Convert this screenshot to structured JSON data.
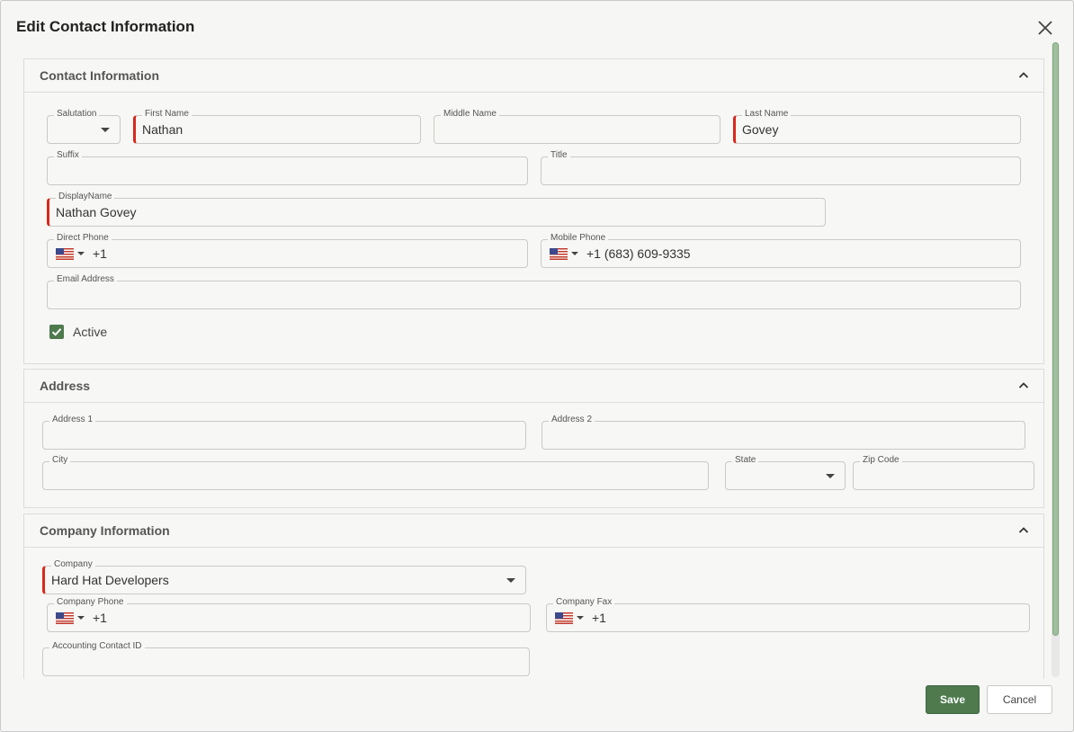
{
  "dialog": {
    "title": "Edit Contact Information"
  },
  "contact_section": {
    "title": "Contact Information",
    "salutation": {
      "label": "Salutation",
      "value": ""
    },
    "first_name": {
      "label": "First Name",
      "value": "Nathan"
    },
    "middle_name": {
      "label": "Middle Name",
      "value": ""
    },
    "last_name": {
      "label": "Last Name",
      "value": "Govey"
    },
    "suffix": {
      "label": "Suffix",
      "value": ""
    },
    "title_field": {
      "label": "Title",
      "value": ""
    },
    "display_name": {
      "label": "DisplayName",
      "value": "Nathan Govey"
    },
    "direct_phone": {
      "label": "Direct Phone",
      "value": "+1"
    },
    "mobile_phone": {
      "label": "Mobile Phone",
      "value": "+1 (683) 609-9335"
    },
    "email": {
      "label": "Email Address",
      "value": ""
    },
    "active": {
      "label": "Active",
      "checked": true
    }
  },
  "address_section": {
    "title": "Address",
    "address1": {
      "label": "Address 1",
      "value": ""
    },
    "address2": {
      "label": "Address 2",
      "value": ""
    },
    "city": {
      "label": "City",
      "value": ""
    },
    "state": {
      "label": "State",
      "value": ""
    },
    "zip": {
      "label": "Zip Code",
      "value": ""
    }
  },
  "company_section": {
    "title": "Company Information",
    "company": {
      "label": "Company",
      "value": "Hard Hat Developers"
    },
    "company_phone": {
      "label": "Company Phone",
      "value": "+1"
    },
    "company_fax": {
      "label": "Company Fax",
      "value": "+1"
    },
    "accounting_id": {
      "label": "Accounting Contact ID",
      "value": ""
    }
  },
  "footer": {
    "save_label": "Save",
    "cancel_label": "Cancel"
  },
  "icons": {
    "close": "close-icon",
    "collapse": "chevron-up-icon",
    "flag": "us-flag-icon"
  },
  "colors": {
    "accent": "#4e7a4e",
    "required": "#d9281c"
  }
}
